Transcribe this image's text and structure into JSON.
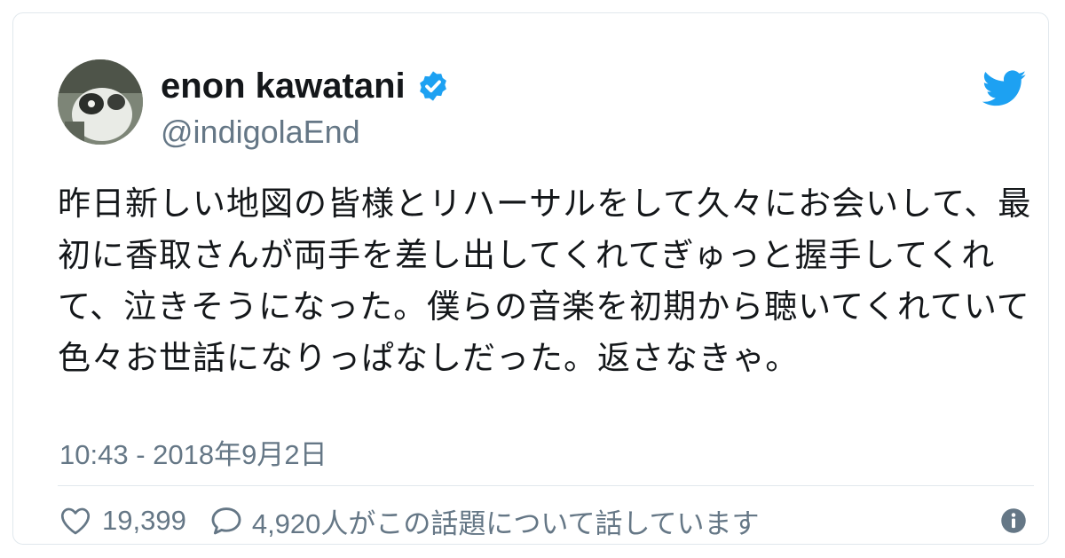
{
  "author": {
    "display_name": "enon kawatani",
    "handle": "@indigolaEnd",
    "verified": true
  },
  "tweet": {
    "text": "昨日新しい地図の皆様とリハーサルをして久々にお会いして、最初に香取さんが両手を差し出してくれてぎゅっと握手してくれて、泣きそうになった。僕らの音楽を初期から聴いてくれていて色々お世話になりっぱなしだった。返さなきゃ。",
    "timestamp": "10:43 - 2018年9月2日"
  },
  "stats": {
    "likes": "19,399",
    "conversation": "4,920人がこの話題について話しています"
  },
  "icons": {
    "verified": "verified-badge-icon",
    "brand": "twitter-bird-icon",
    "like": "heart-icon",
    "reply": "speech-bubble-icon",
    "info": "info-icon"
  },
  "colors": {
    "brand_blue": "#1da1f2",
    "text": "#14171a",
    "muted": "#657786"
  }
}
